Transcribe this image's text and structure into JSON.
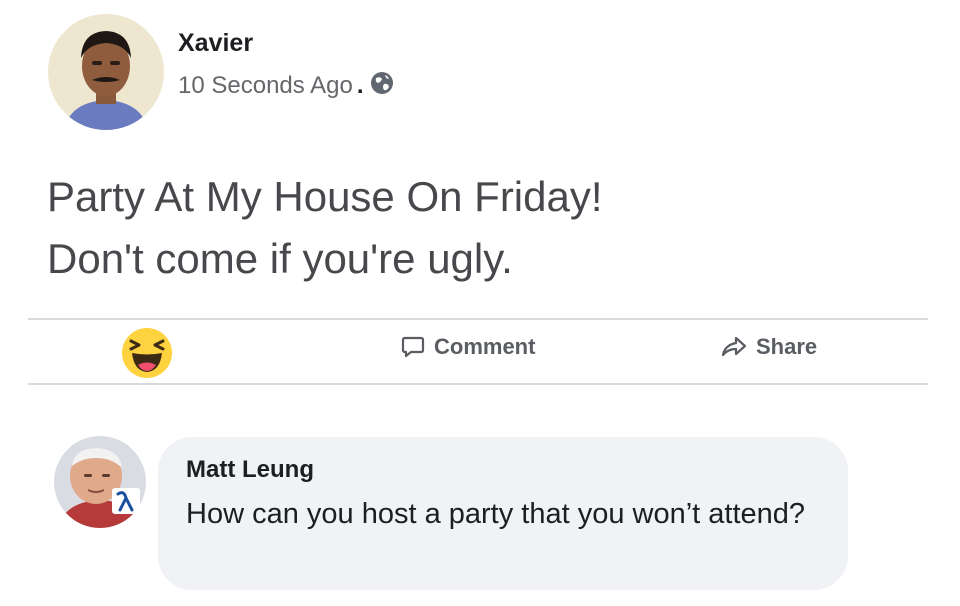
{
  "post": {
    "author": "Xavier",
    "timestamp": "10 Seconds Ago",
    "separator": ".",
    "privacy_icon": "globe-icon",
    "text_line1": "Party At My House On Friday!",
    "text_line2": "Don't come if you're ugly."
  },
  "actions": {
    "reaction_icon": "haha-emoji-icon",
    "comment_label": "Comment",
    "share_label": "Share"
  },
  "comment": {
    "author": "Matt Leung",
    "text": "How can you host a party that you won’t attend?"
  },
  "colors": {
    "bubble_bg": "#f0f2f5",
    "muted_text": "#65676b",
    "emoji_yellow": "#ffd23f"
  }
}
